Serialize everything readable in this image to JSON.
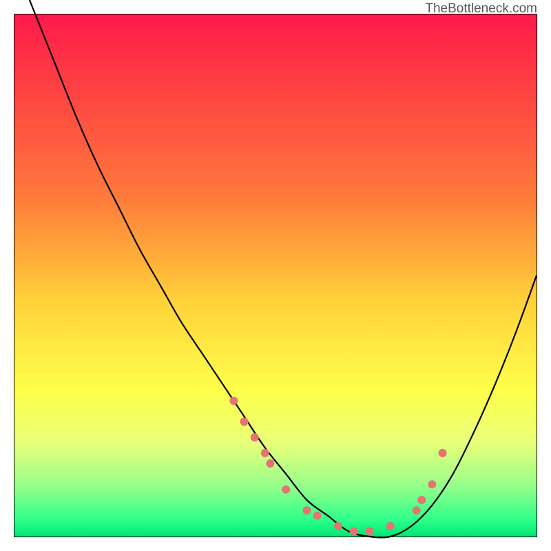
{
  "watermark": "TheBottleneck.com",
  "chart_data": {
    "type": "line",
    "title": "",
    "xlabel": "",
    "ylabel": "",
    "xlim": [
      0,
      100
    ],
    "ylim": [
      0,
      100
    ],
    "gradient": {
      "stops": [
        {
          "offset": 0,
          "color": "#ff1a4a"
        },
        {
          "offset": 35,
          "color": "#ff7a3a"
        },
        {
          "offset": 55,
          "color": "#ffd23a"
        },
        {
          "offset": 72,
          "color": "#ffff4a"
        },
        {
          "offset": 82,
          "color": "#e8ff7a"
        },
        {
          "offset": 90,
          "color": "#9aff8a"
        },
        {
          "offset": 97,
          "color": "#2aff8a"
        },
        {
          "offset": 100,
          "color": "#00e676"
        }
      ]
    },
    "series": [
      {
        "name": "bottleneck-curve",
        "x": [
          0,
          4,
          8,
          12,
          16,
          20,
          24,
          28,
          32,
          36,
          40,
          44,
          48,
          52,
          56,
          60,
          64,
          68,
          72,
          76,
          80,
          84,
          88,
          92,
          96,
          100
        ],
        "y": [
          110,
          100,
          90,
          80,
          71,
          63,
          55,
          48,
          41,
          35,
          29,
          23,
          17,
          12,
          7,
          4,
          1,
          0,
          0,
          2,
          6,
          12,
          20,
          29,
          39,
          50
        ]
      }
    ],
    "markers": {
      "name": "highlight-points",
      "x": [
        42,
        44,
        46,
        48,
        49,
        52,
        56,
        58,
        62,
        65,
        68,
        72,
        77,
        78,
        80,
        82
      ],
      "y": [
        26,
        22,
        19,
        16,
        14,
        9,
        5,
        4,
        2,
        1,
        1,
        2,
        5,
        7,
        10,
        16
      ],
      "color": "#e57373",
      "radius": 6
    }
  }
}
